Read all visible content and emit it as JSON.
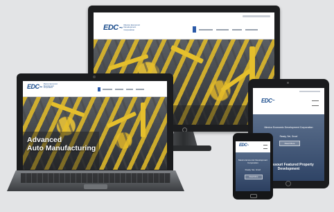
{
  "logo": {
    "mark": "EDC",
    "tagline": "Mexico Economic Development Corporation"
  },
  "laptop": {
    "hero_line1": "Advanced",
    "hero_line2": "Auto Manufacturing"
  },
  "tablet": {
    "overlay_title": "Mexico Economic Development Corporation",
    "overlay_sub": "Ready, Set, Grow!",
    "cta": "Read More",
    "bottom_caption": "Ln Missouri Featured Property Development"
  },
  "phone": {
    "overlay_title": "Mexico Economic Development Corporation",
    "overlay_sub": "Ready, Set, Grow!",
    "cta": "Read More"
  },
  "colors": {
    "brand_blue": "#1a4c8c",
    "brand_green": "#6cb33f",
    "nav_blue": "#2b5aa8",
    "background": "#e3e4e6"
  },
  "icons": [
    "monitor",
    "laptop",
    "tablet",
    "phone",
    "power-button",
    "home-button"
  ]
}
